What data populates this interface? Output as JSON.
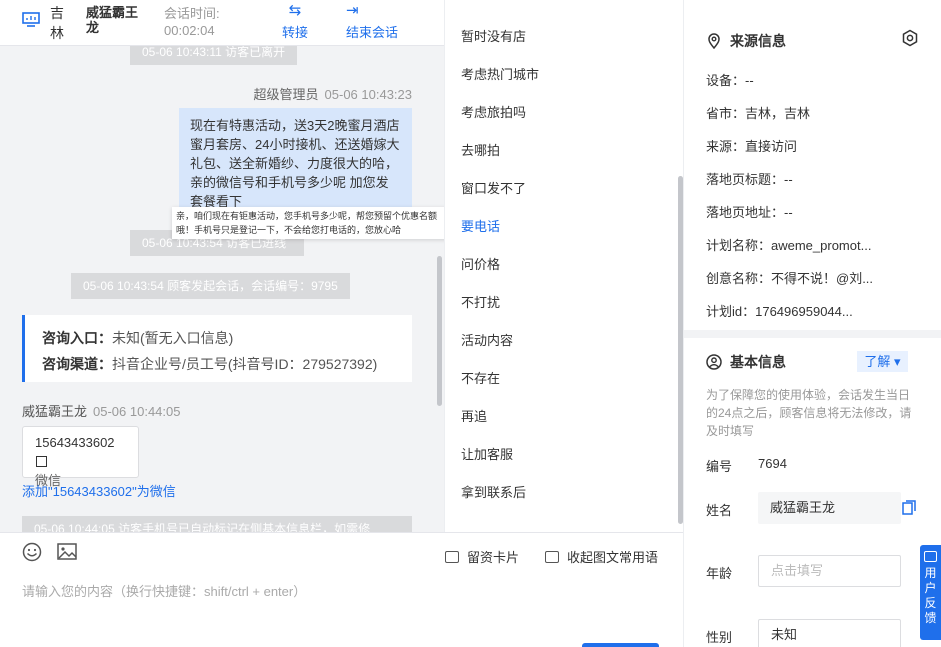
{
  "header": {
    "location": "吉林",
    "visitor_name": "威猛霸王龙",
    "session_time_label": "会话时间:",
    "session_time": "00:02:04",
    "transfer_label": "转接",
    "end_label": "结束会话"
  },
  "chat": {
    "sys_left": "05-06 10:43:11 访客已离开",
    "agent_name": "超级管理员",
    "agent_time": "05-06 10:43:23",
    "agent_message": "现在有特惠活动，送3天2晚蜜月酒店蜜月套房、24小时接机、还送婚嫁大礼包、送全新婚纱、力度很大的哈，亲的微信号和手机号多少呢 加您发套餐看下",
    "sys_entered": "05-06 10:43:54 访客已进线",
    "tooltip": "亲，咱们现在有钜惠活动，您手机号多少呢，帮您预留个优惠名额哦！手机号只是登记一下，不会给您打电话的，您放心哈",
    "sys_session": "05-06 10:43:54 顾客发起会话，会话编号：9795",
    "entry_label": "咨询入口：",
    "entry_value": "未知(暂无入口信息)",
    "channel_label": "咨询渠道：",
    "channel_value": "抖音企业号/员工号(抖音号ID：279527392)",
    "visitor_name": "威猛霸王龙",
    "visitor_time": "05-06 10:44:05",
    "phone": "15643433602",
    "phone_type": "微信",
    "add_wechat": "添加\"15643433602\"为微信",
    "sys_bottom": "05-06 10:44:05 访客手机号已自动标记在侧基本信息栏，如需修"
  },
  "input": {
    "card_label": "留资卡片",
    "fold_label": "收起图文常用语",
    "placeholder": "请输入您的内容（换行快捷键：shift/ctrl + enter）"
  },
  "quick_replies": {
    "items": [
      "暂时没有店",
      "考虑热门城市",
      "考虑旅拍吗",
      "去哪拍",
      "窗口发不了",
      "要电话",
      "问价格",
      "不打扰",
      "活动内容",
      "不存在",
      "再追",
      "让加客服",
      "拿到联系后"
    ],
    "active_index": 5
  },
  "source": {
    "title": "来源信息",
    "device": "设备：--",
    "province": "省市：吉林，吉林",
    "origin": "来源：直接访问",
    "landing_title": "落地页标题：--",
    "landing_url": "落地页地址：--",
    "plan_name": "计划名称：aweme_promot...",
    "creative_name": "创意名称：不得不说！@刘...",
    "plan_id": "计划id：176496959044..."
  },
  "basic": {
    "title": "基本信息",
    "learn_label": "了解 ▾",
    "notice": "为了保障您的使用体验，会话发生当日的24点之后，顾客信息将无法修改，请及时填写",
    "id_label": "编号",
    "id_value": "7694",
    "name_label": "姓名",
    "name_value": "威猛霸王龙",
    "age_label": "年龄",
    "age_placeholder": "点击填写",
    "gender_label": "性别",
    "gender_value": "未知"
  },
  "feedback": {
    "label": "用户反馈"
  },
  "colors": {
    "accent": "#1f6feb",
    "bubble": "#d7e6fb",
    "chat_bg": "#f2f3f5"
  }
}
